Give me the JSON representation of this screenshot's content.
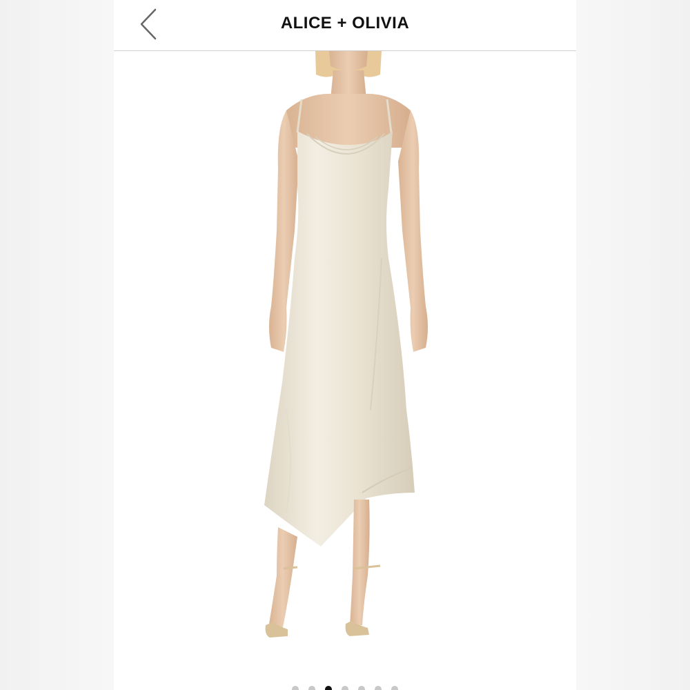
{
  "header": {
    "title": "ALICE + OLIVIA",
    "back_icon": "chevron-left-icon"
  },
  "gallery": {
    "image_subject": "satin-slip-dress-photo",
    "total_slides": 7,
    "active_slide": 3
  },
  "colors": {
    "dress": "#ece6d8",
    "skin": "#e8c9ad",
    "hair": "#e8c99a",
    "sandal": "#d9c29a"
  }
}
